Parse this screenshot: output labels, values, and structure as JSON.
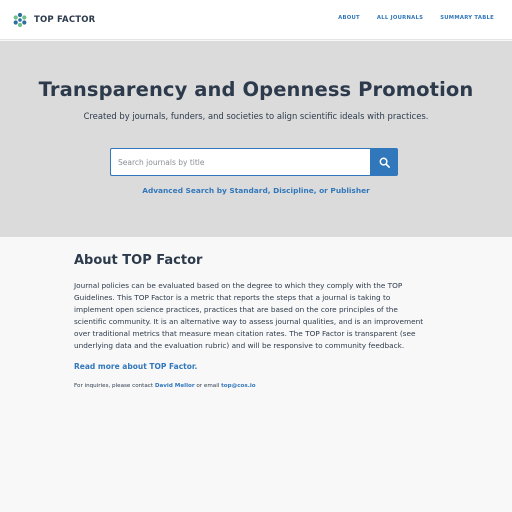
{
  "header": {
    "brand_name": "TOP FACTOR",
    "logo_icon": "top-factor-logo-icon",
    "nav": [
      {
        "label": "ABOUT"
      },
      {
        "label": "ALL JOURNALS"
      },
      {
        "label": "SUMMARY TABLE"
      }
    ]
  },
  "hero": {
    "title": "Transparency and Openness Promotion",
    "subtitle": "Created by journals, funders, and societies to align scientific ideals with practices.",
    "search": {
      "placeholder": "Search journals by title",
      "value": "",
      "button_icon": "search-icon"
    },
    "advanced_search_label": "Advanced Search by Standard, Discipline, or Publisher"
  },
  "about": {
    "title": "About TOP Factor",
    "body": "Journal policies can be evaluated based on the degree to which they comply with the TOP Guidelines. This TOP Factor is a metric that reports the steps that a journal is taking to implement open science practices, practices that are based on the core principles of the scientific community. It is an alternative way to assess journal qualities, and is an improvement over traditional metrics that measure mean citation rates. The TOP Factor is transparent (see underlying data and the evaluation rubric) and will be responsive to community feedback.",
    "read_more_label": "Read more about TOP Factor.",
    "inquiries_prefix": "For inquiries, please contact",
    "contact_name": "David Mellor",
    "inquiries_middle": "or email",
    "contact_email": "top@cos.io"
  },
  "colors": {
    "accent": "#3177bb",
    "text": "#2c3a4b",
    "hero_bg": "#dbdbdb",
    "page_bg": "#f8f8f8",
    "logo_blue": "#2a6f9e",
    "logo_green": "#6fbf8a"
  }
}
